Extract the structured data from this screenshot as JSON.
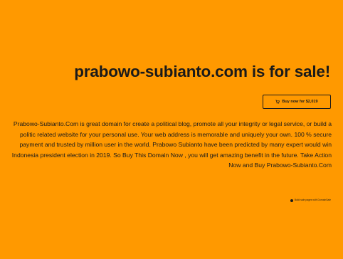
{
  "page": {
    "background_color": "#ff9900",
    "text_color": "#1a1a1a"
  },
  "headline": {
    "text": "prabowo-subianto.com is for sale!"
  },
  "buy_button": {
    "icon": "cart-icon",
    "label": "Buy now for $2,019"
  },
  "description": {
    "text": "Prabowo-Subianto.Com is great domain for create a political blog, promote all your integrity or legal service, or build a politic related website for your personal use. Your web address is memorable and uniquely your own. 100 % secure payment and trusted by million user in the world. Prabowo Subianto have been predicted by many expert would win Indonesia president election in 2019. So Buy This Domain Now , you will get amazing benefit in the future. Take Action Now and Buy Prabowo-Subianto.Com"
  },
  "footnote": {
    "icon": "info-icon",
    "text": "Build sale pages with DomainSale"
  }
}
